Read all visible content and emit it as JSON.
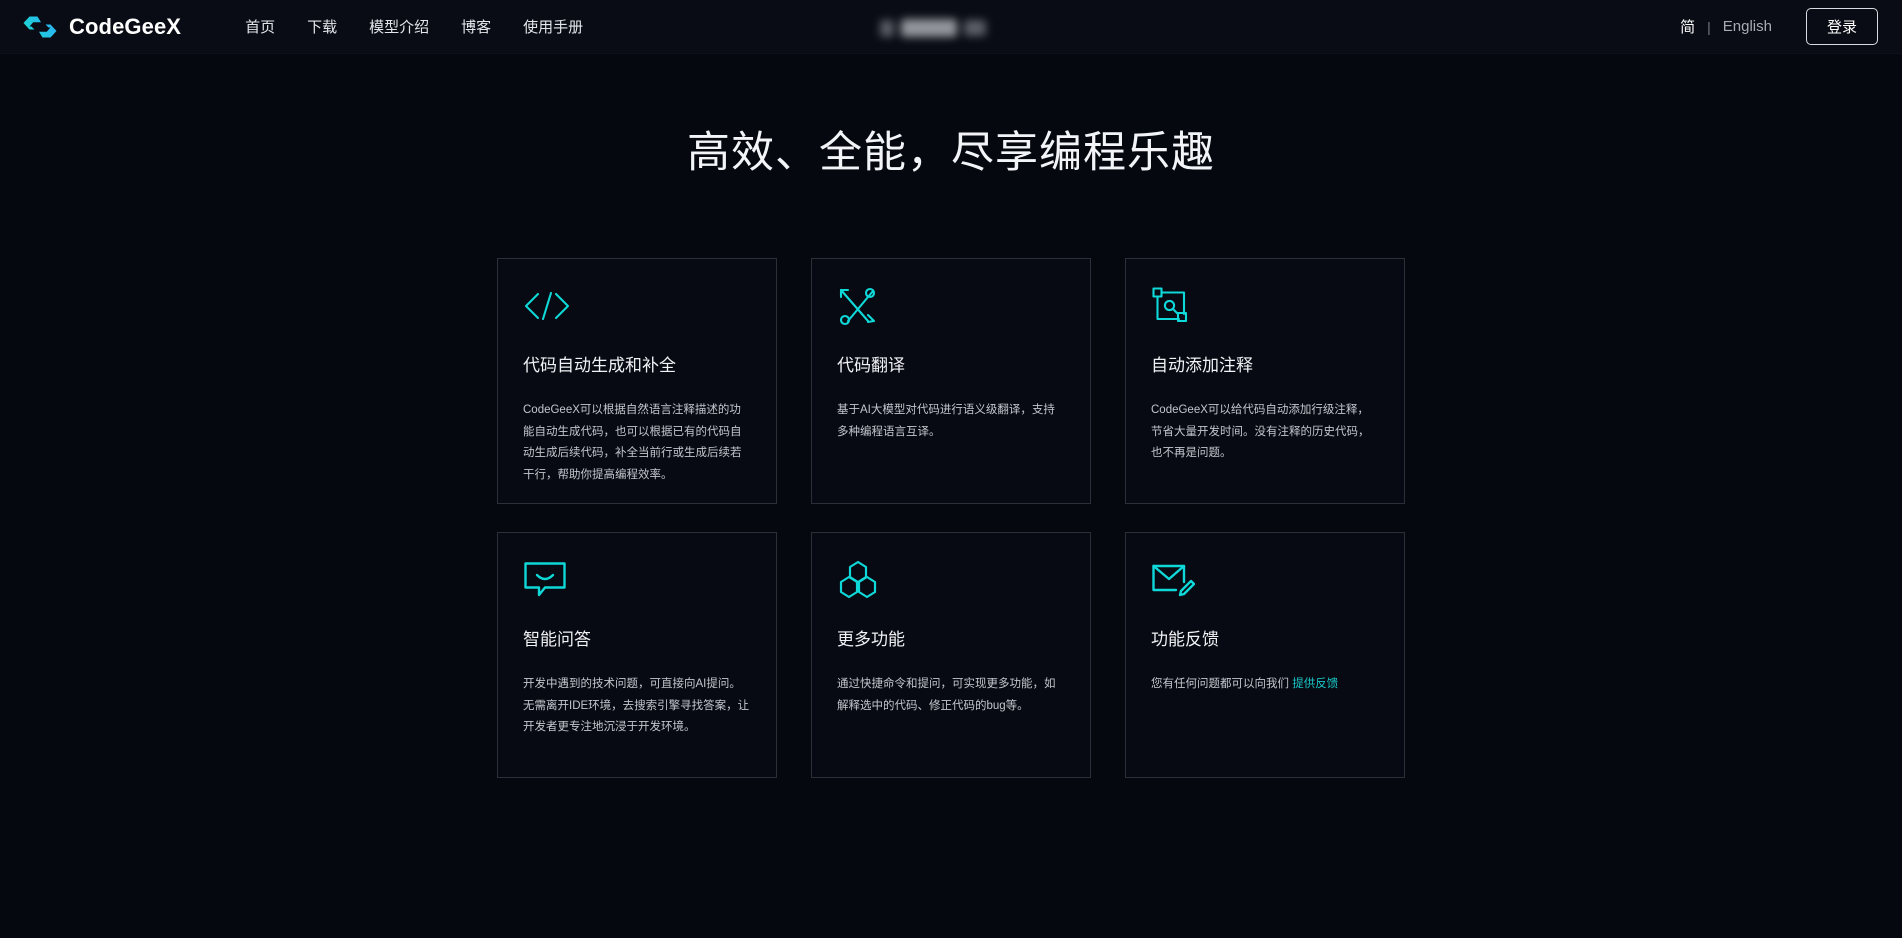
{
  "theme": {
    "background": "#05080f",
    "header_background": "#090c14",
    "accent": "#19c6c6",
    "logo_gradient_from": "#18e0c8",
    "logo_gradient_to": "#2fa8ff",
    "card_border": "#2a3039",
    "text_primary": "#f0f2f5",
    "text_secondary": "#c2c6cd"
  },
  "header": {
    "brand": {
      "name": "CodeGeeX",
      "logo_icon": "codegeex-brackets-logo"
    },
    "nav": [
      {
        "label": "首页"
      },
      {
        "label": "下载"
      },
      {
        "label": "模型介绍"
      },
      {
        "label": "博客"
      },
      {
        "label": "使用手册"
      }
    ],
    "center_blurred": {
      "note": "blurred-redacted-element"
    },
    "language": {
      "zh_label": "简",
      "separator": "|",
      "en_label": "English"
    },
    "login_label": "登录"
  },
  "main": {
    "hero_title": "高效、全能，尽享编程乐趣",
    "cards": [
      {
        "icon": "code-brackets-icon",
        "title": "代码自动生成和补全",
        "desc": "CodeGeeX可以根据自然语言注释描述的功能自动生成代码，也可以根据已有的代码自动生成后续代码，补全当前行或生成后续若干行，帮助你提高编程效率。"
      },
      {
        "icon": "translate-arrows-icon",
        "title": "代码翻译",
        "desc": "基于AI大模型对代码进行语义级翻译，支持多种编程语言互译。"
      },
      {
        "icon": "annotate-nodes-icon",
        "title": "自动添加注释",
        "desc": "CodeGeeX可以给代码自动添加行级注释，节省大量开发时间。没有注释的历史代码，也不再是问题。"
      },
      {
        "icon": "chat-bubble-smile-icon",
        "title": "智能问答",
        "desc": "开发中遇到的技术问题，可直接向AI提问。无需离开IDE环境，去搜索引擎寻找答案，让开发者更专注地沉浸于开发环境。"
      },
      {
        "icon": "hexagons-cluster-icon",
        "title": "更多功能",
        "desc": "通过快捷命令和提问，可实现更多功能，如解释选中的代码、修正代码的bug等。"
      },
      {
        "icon": "envelope-pencil-icon",
        "title": "功能反馈",
        "desc_prefix": "您有任何问题都可以向我们 ",
        "link_label": "提供反馈"
      }
    ]
  }
}
